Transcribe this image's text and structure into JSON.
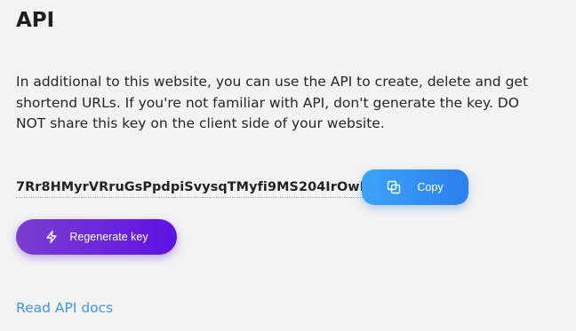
{
  "page": {
    "title": "API",
    "description": "In additional to this website, you can use the API to create, delete and get shortend URLs. If you're not familiar with API, don't generate the key. DO NOT share this key on the client side of your website."
  },
  "api_key": {
    "value": "7Rr8HMyrVRruGsPpdpiSvysqTMyfi9MS204IrOwK",
    "copy_label": "Copy",
    "copy_icon": "copy-icon"
  },
  "regenerate": {
    "label": "Regenerate key",
    "icon": "lightning-icon"
  },
  "links": {
    "docs_label": "Read API docs"
  },
  "colors": {
    "background": "#f3f3f3",
    "copy_button": "#3a93f4",
    "regenerate_button": "#6a25dc",
    "link": "#3e97e6"
  }
}
